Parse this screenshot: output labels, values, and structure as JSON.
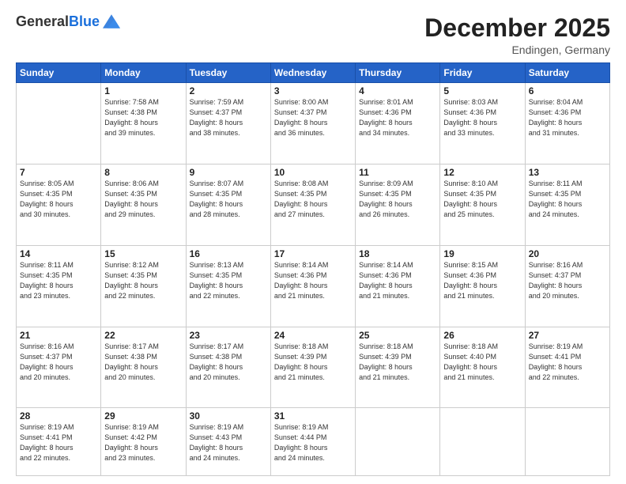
{
  "logo": {
    "general": "General",
    "blue": "Blue"
  },
  "header": {
    "month_year": "December 2025",
    "location": "Endingen, Germany"
  },
  "weekdays": [
    "Sunday",
    "Monday",
    "Tuesday",
    "Wednesday",
    "Thursday",
    "Friday",
    "Saturday"
  ],
  "weeks": [
    [
      {
        "day": "",
        "info": ""
      },
      {
        "day": "1",
        "info": "Sunrise: 7:58 AM\nSunset: 4:38 PM\nDaylight: 8 hours\nand 39 minutes."
      },
      {
        "day": "2",
        "info": "Sunrise: 7:59 AM\nSunset: 4:37 PM\nDaylight: 8 hours\nand 38 minutes."
      },
      {
        "day": "3",
        "info": "Sunrise: 8:00 AM\nSunset: 4:37 PM\nDaylight: 8 hours\nand 36 minutes."
      },
      {
        "day": "4",
        "info": "Sunrise: 8:01 AM\nSunset: 4:36 PM\nDaylight: 8 hours\nand 34 minutes."
      },
      {
        "day": "5",
        "info": "Sunrise: 8:03 AM\nSunset: 4:36 PM\nDaylight: 8 hours\nand 33 minutes."
      },
      {
        "day": "6",
        "info": "Sunrise: 8:04 AM\nSunset: 4:36 PM\nDaylight: 8 hours\nand 31 minutes."
      }
    ],
    [
      {
        "day": "7",
        "info": "Sunrise: 8:05 AM\nSunset: 4:35 PM\nDaylight: 8 hours\nand 30 minutes."
      },
      {
        "day": "8",
        "info": "Sunrise: 8:06 AM\nSunset: 4:35 PM\nDaylight: 8 hours\nand 29 minutes."
      },
      {
        "day": "9",
        "info": "Sunrise: 8:07 AM\nSunset: 4:35 PM\nDaylight: 8 hours\nand 28 minutes."
      },
      {
        "day": "10",
        "info": "Sunrise: 8:08 AM\nSunset: 4:35 PM\nDaylight: 8 hours\nand 27 minutes."
      },
      {
        "day": "11",
        "info": "Sunrise: 8:09 AM\nSunset: 4:35 PM\nDaylight: 8 hours\nand 26 minutes."
      },
      {
        "day": "12",
        "info": "Sunrise: 8:10 AM\nSunset: 4:35 PM\nDaylight: 8 hours\nand 25 minutes."
      },
      {
        "day": "13",
        "info": "Sunrise: 8:11 AM\nSunset: 4:35 PM\nDaylight: 8 hours\nand 24 minutes."
      }
    ],
    [
      {
        "day": "14",
        "info": "Sunrise: 8:11 AM\nSunset: 4:35 PM\nDaylight: 8 hours\nand 23 minutes."
      },
      {
        "day": "15",
        "info": "Sunrise: 8:12 AM\nSunset: 4:35 PM\nDaylight: 8 hours\nand 22 minutes."
      },
      {
        "day": "16",
        "info": "Sunrise: 8:13 AM\nSunset: 4:35 PM\nDaylight: 8 hours\nand 22 minutes."
      },
      {
        "day": "17",
        "info": "Sunrise: 8:14 AM\nSunset: 4:36 PM\nDaylight: 8 hours\nand 21 minutes."
      },
      {
        "day": "18",
        "info": "Sunrise: 8:14 AM\nSunset: 4:36 PM\nDaylight: 8 hours\nand 21 minutes."
      },
      {
        "day": "19",
        "info": "Sunrise: 8:15 AM\nSunset: 4:36 PM\nDaylight: 8 hours\nand 21 minutes."
      },
      {
        "day": "20",
        "info": "Sunrise: 8:16 AM\nSunset: 4:37 PM\nDaylight: 8 hours\nand 20 minutes."
      }
    ],
    [
      {
        "day": "21",
        "info": "Sunrise: 8:16 AM\nSunset: 4:37 PM\nDaylight: 8 hours\nand 20 minutes."
      },
      {
        "day": "22",
        "info": "Sunrise: 8:17 AM\nSunset: 4:38 PM\nDaylight: 8 hours\nand 20 minutes."
      },
      {
        "day": "23",
        "info": "Sunrise: 8:17 AM\nSunset: 4:38 PM\nDaylight: 8 hours\nand 20 minutes."
      },
      {
        "day": "24",
        "info": "Sunrise: 8:18 AM\nSunset: 4:39 PM\nDaylight: 8 hours\nand 21 minutes."
      },
      {
        "day": "25",
        "info": "Sunrise: 8:18 AM\nSunset: 4:39 PM\nDaylight: 8 hours\nand 21 minutes."
      },
      {
        "day": "26",
        "info": "Sunrise: 8:18 AM\nSunset: 4:40 PM\nDaylight: 8 hours\nand 21 minutes."
      },
      {
        "day": "27",
        "info": "Sunrise: 8:19 AM\nSunset: 4:41 PM\nDaylight: 8 hours\nand 22 minutes."
      }
    ],
    [
      {
        "day": "28",
        "info": "Sunrise: 8:19 AM\nSunset: 4:41 PM\nDaylight: 8 hours\nand 22 minutes."
      },
      {
        "day": "29",
        "info": "Sunrise: 8:19 AM\nSunset: 4:42 PM\nDaylight: 8 hours\nand 23 minutes."
      },
      {
        "day": "30",
        "info": "Sunrise: 8:19 AM\nSunset: 4:43 PM\nDaylight: 8 hours\nand 24 minutes."
      },
      {
        "day": "31",
        "info": "Sunrise: 8:19 AM\nSunset: 4:44 PM\nDaylight: 8 hours\nand 24 minutes."
      },
      {
        "day": "",
        "info": ""
      },
      {
        "day": "",
        "info": ""
      },
      {
        "day": "",
        "info": ""
      }
    ]
  ]
}
